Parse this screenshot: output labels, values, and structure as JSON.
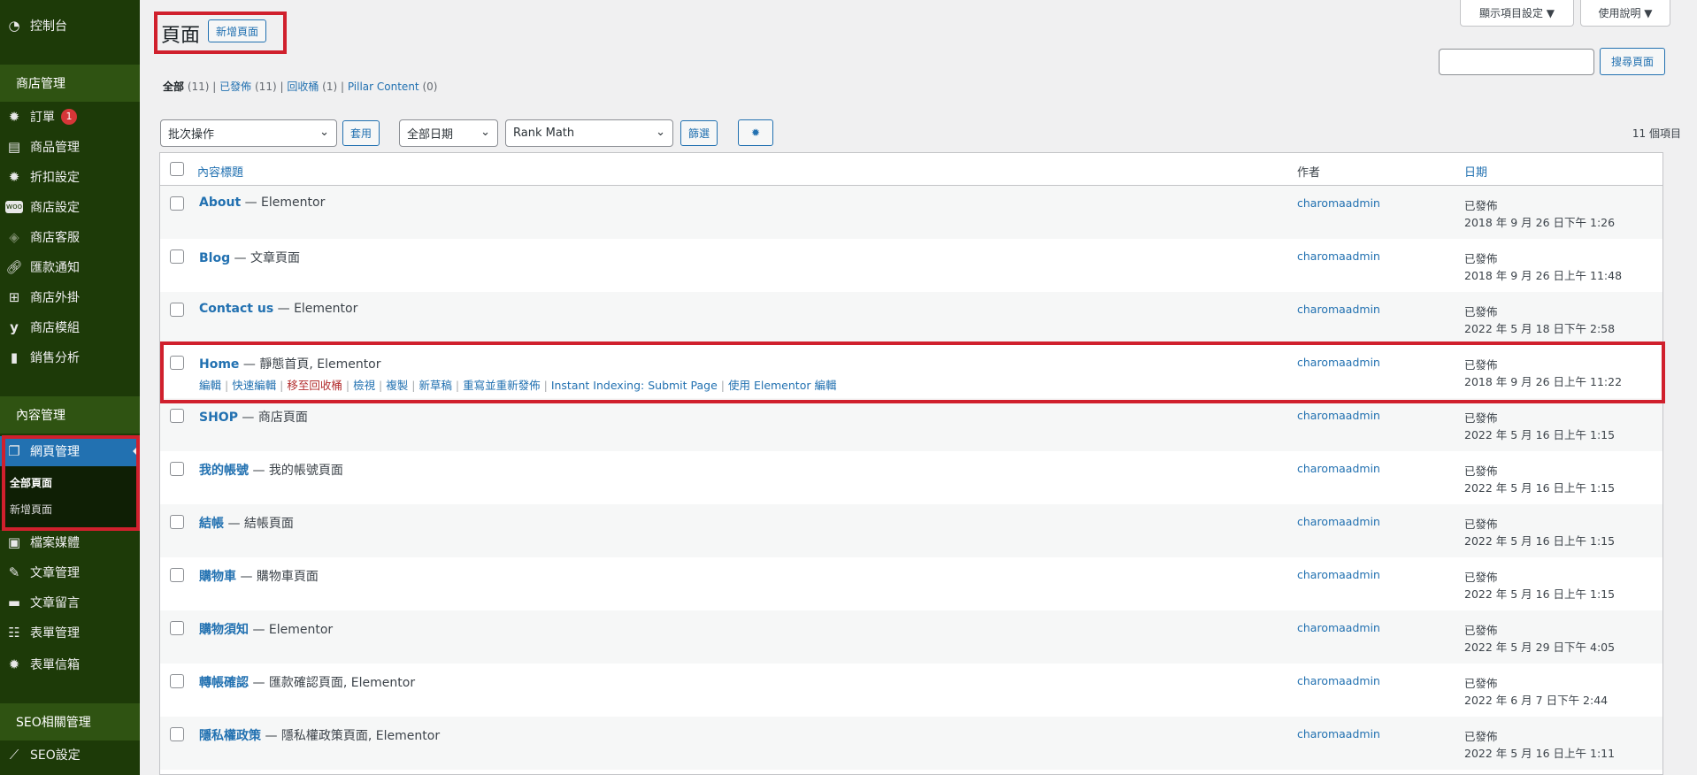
{
  "sidebar": {
    "dashboard": "控制台",
    "section_shop": "商店管理",
    "orders": "訂單",
    "orders_badge": "1",
    "products": "商品管理",
    "discounts": "折扣設定",
    "shop_settings": "商店設定",
    "customer_service": "商店客服",
    "payment_notice": "匯款通知",
    "shop_addons": "商店外掛",
    "shop_modules": "商店模組",
    "sales_analytics": "銷售分析",
    "section_content": "內容管理",
    "pages": "網頁管理",
    "all_pages": "全部頁面",
    "add_page": "新增頁面",
    "media": "檔案媒體",
    "posts": "文章管理",
    "comments": "文章留言",
    "forms": "表單管理",
    "form_inbox": "表單信箱",
    "section_seo": "SEO相關管理",
    "seo_settings": "SEO設定"
  },
  "header": {
    "title": "頁面",
    "add_new": "新增頁面",
    "screen_options": "顯示項目設定 ▼",
    "help": "使用說明 ▼"
  },
  "views": {
    "all": "全部",
    "all_count": "(11)",
    "published": "已發佈",
    "published_count": "(11)",
    "trash": "回收桶",
    "trash_count": "(1)",
    "pillar": "Pillar Content",
    "pillar_count": "(0)"
  },
  "search": {
    "button": "搜尋頁面",
    "value": ""
  },
  "filters": {
    "bulk": "批次操作",
    "apply": "套用",
    "dates": "全部日期",
    "rankmath": "Rank Math",
    "filter": "篩選",
    "items": "11 個項目"
  },
  "table": {
    "col_title": "內容標題",
    "col_author": "作者",
    "col_date": "日期",
    "rows": [
      {
        "title": "About",
        "suffix": " — Elementor",
        "author": "charomaadmin",
        "status": "已發佈",
        "date": "2018 年 9 月 26 日下午 1:26"
      },
      {
        "title": "Blog",
        "suffix": " — 文章頁面",
        "author": "charomaadmin",
        "status": "已發佈",
        "date": "2018 年 9 月 26 日上午 11:48"
      },
      {
        "title": "Contact us",
        "suffix": " — Elementor",
        "author": "charomaadmin",
        "status": "已發佈",
        "date": "2022 年 5 月 18 日下午 2:58"
      },
      {
        "title": "Home",
        "suffix": " — 靜態首頁, Elementor",
        "author": "charomaadmin",
        "status": "已發佈",
        "date": "2018 年 9 月 26 日上午 11:22"
      },
      {
        "title": "SHOP",
        "suffix": " — 商店頁面",
        "author": "charomaadmin",
        "status": "已發佈",
        "date": "2022 年 5 月 16 日上午 1:15"
      },
      {
        "title": "我的帳號",
        "suffix": " — 我的帳號頁面",
        "author": "charomaadmin",
        "status": "已發佈",
        "date": "2022 年 5 月 16 日上午 1:15"
      },
      {
        "title": "結帳",
        "suffix": " — 結帳頁面",
        "author": "charomaadmin",
        "status": "已發佈",
        "date": "2022 年 5 月 16 日上午 1:15"
      },
      {
        "title": "購物車",
        "suffix": " — 購物車頁面",
        "author": "charomaadmin",
        "status": "已發佈",
        "date": "2022 年 5 月 16 日上午 1:15"
      },
      {
        "title": "購物須知",
        "suffix": " — Elementor",
        "author": "charomaadmin",
        "status": "已發佈",
        "date": "2022 年 5 月 29 日下午 4:05"
      },
      {
        "title": "轉帳確認",
        "suffix": " — 匯款確認頁面, Elementor",
        "author": "charomaadmin",
        "status": "已發佈",
        "date": "2022 年 6 月 7 日下午 2:44"
      },
      {
        "title": "隱私權政策",
        "suffix": " — 隱私權政策頁面, Elementor",
        "author": "charomaadmin",
        "status": "已發佈",
        "date": "2022 年 5 月 16 日上午 1:11"
      }
    ],
    "row_actions": {
      "edit": "編輯",
      "quick_edit": "快速編輯",
      "trash": "移至回收桶",
      "view": "檢視",
      "copy": "複製",
      "new_draft": "新草稿",
      "republish": "重寫並重新發佈",
      "indexing": "Instant Indexing: Submit Page",
      "elementor": "使用 Elementor 編輯"
    }
  }
}
